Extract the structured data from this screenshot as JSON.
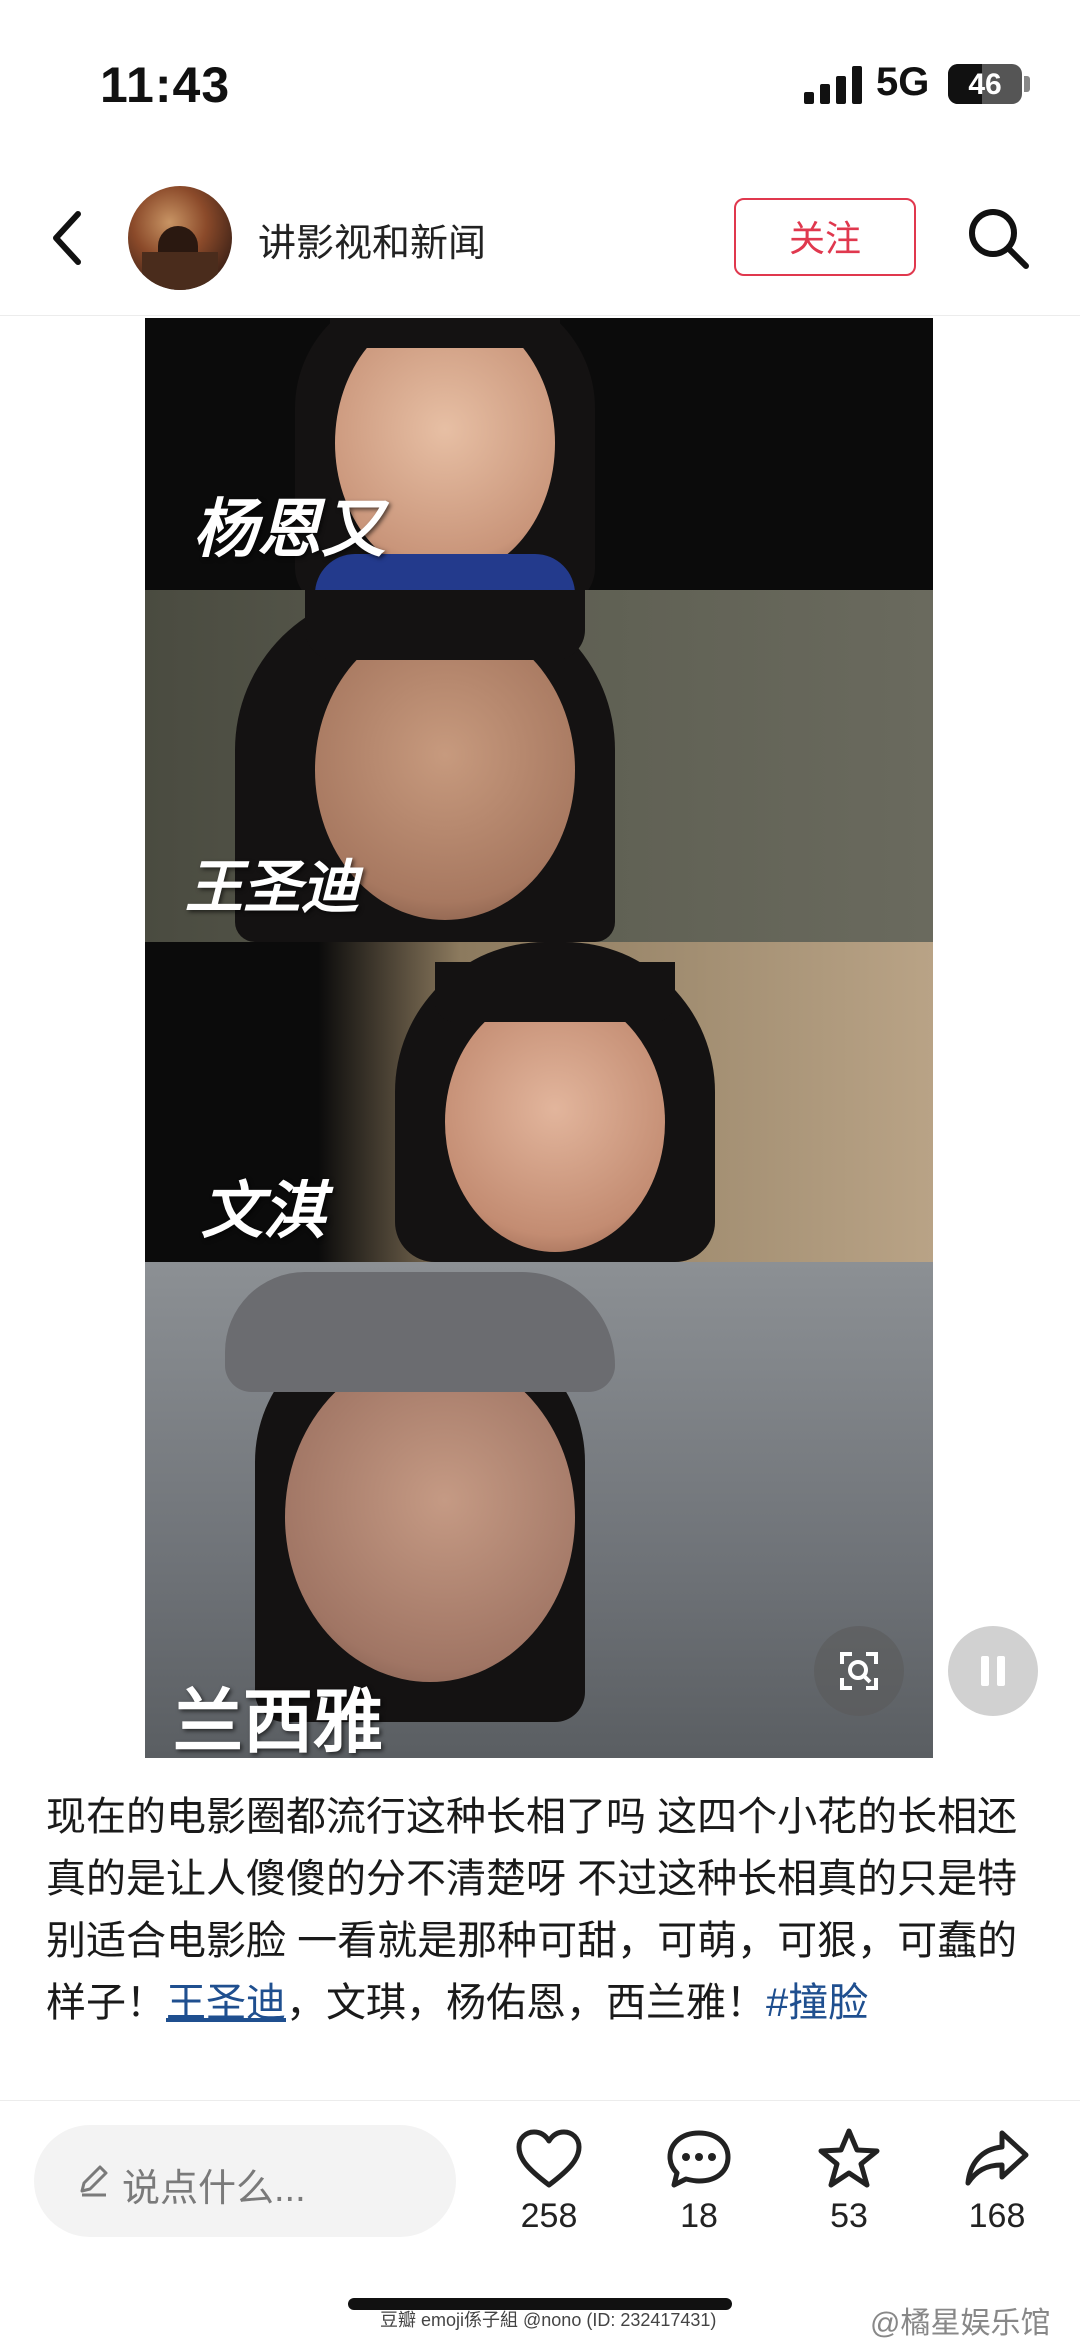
{
  "status_bar": {
    "time": "11:43",
    "network": "5G",
    "battery": "46",
    "battery_level": 0.46
  },
  "header": {
    "account_name": "讲影视和新闻",
    "follow_label": "关注"
  },
  "photo_captions": [
    "杨恩又",
    "王圣迪",
    "文淇",
    "兰西雅"
  ],
  "post": {
    "text_part1": "现在的电影圈都流行这种长相了吗 这四个小花的长相还真的是让人傻傻的分不清楚呀 不过这种长相真的只是特别适合电影脸 一看就是那种可甜，可萌，可狠，可蠢的样子！",
    "mention": "王圣迪",
    "text_part2": "，文琪，杨佑恩，西兰雅！",
    "hashtag": "#撞脸"
  },
  "action_bar": {
    "comment_placeholder": "说点什么...",
    "like_count": "258",
    "comment_count": "18",
    "favorite_count": "53",
    "share_count": "168"
  },
  "watermarks": {
    "left": "豆瓣 emoji係子組 @nono (ID: 232417431)",
    "right": "@橘星娱乐馆"
  },
  "colors": {
    "accent_red": "#e0384e",
    "link_blue": "#1f4f8f"
  },
  "icons": [
    "back-icon",
    "search-icon",
    "pencil-icon",
    "heart-icon",
    "chat-bubble-icon",
    "star-icon",
    "share-icon",
    "scan-icon",
    "pause-icon"
  ]
}
